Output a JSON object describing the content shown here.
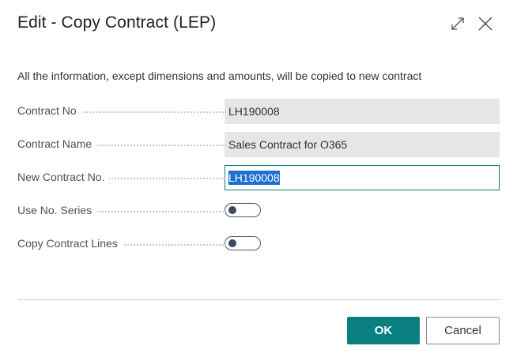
{
  "dialog": {
    "title": "Edit - Copy Contract (LEP)",
    "icons": {
      "expand": "expand-arrows-icon",
      "close": "close-x-icon"
    },
    "description": "All the information, except dimensions and amounts, will be copied to new contract"
  },
  "fields": {
    "contract_no": {
      "label": "Contract No",
      "value": "LH190008"
    },
    "contract_name": {
      "label": "Contract Name",
      "value": "Sales Contract for O365"
    },
    "new_contract_no": {
      "label": "New Contract No.",
      "value": "LH190008"
    },
    "use_no_series": {
      "label": "Use No. Series",
      "state": "off"
    },
    "copy_contract_lines": {
      "label": "Copy Contract Lines",
      "state": "off"
    }
  },
  "buttons": {
    "ok": "OK",
    "cancel": "Cancel"
  },
  "colors": {
    "accent": "#0a7f80",
    "selection": "#1f6fd1",
    "readonly_bg": "#e6e6e6"
  }
}
